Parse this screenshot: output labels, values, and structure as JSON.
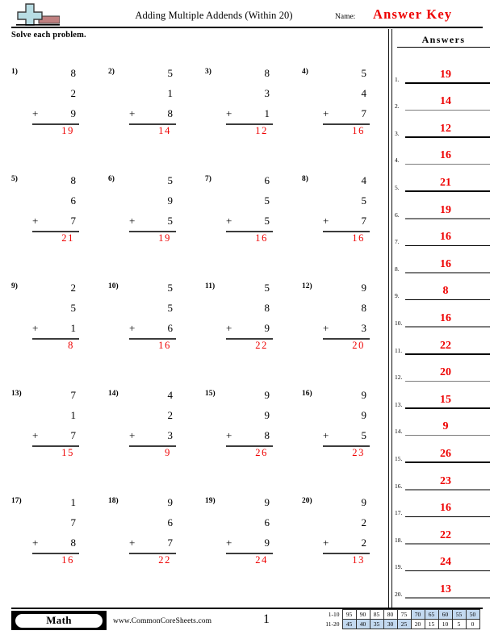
{
  "header": {
    "logo_icon": "plus-block-logo",
    "title": "Adding Multiple Addends (Within 20)",
    "name_label": "Name:",
    "answer_key_label": "Answer Key",
    "instruction": "Solve each problem."
  },
  "answers_panel": {
    "heading": "Answers",
    "items": [
      {
        "number": "1.",
        "value": "19"
      },
      {
        "number": "2.",
        "value": "14"
      },
      {
        "number": "3.",
        "value": "12"
      },
      {
        "number": "4.",
        "value": "16"
      },
      {
        "number": "5.",
        "value": "21"
      },
      {
        "number": "6.",
        "value": "19"
      },
      {
        "number": "7.",
        "value": "16"
      },
      {
        "number": "8.",
        "value": "16"
      },
      {
        "number": "9.",
        "value": "8"
      },
      {
        "number": "10.",
        "value": "16"
      },
      {
        "number": "11.",
        "value": "22"
      },
      {
        "number": "12.",
        "value": "20"
      },
      {
        "number": "13.",
        "value": "15"
      },
      {
        "number": "14.",
        "value": "9"
      },
      {
        "number": "15.",
        "value": "26"
      },
      {
        "number": "16.",
        "value": "23"
      },
      {
        "number": "17.",
        "value": "16"
      },
      {
        "number": "18.",
        "value": "22"
      },
      {
        "number": "19.",
        "value": "24"
      },
      {
        "number": "20.",
        "value": "13"
      }
    ]
  },
  "problems": [
    {
      "number": "1)",
      "a": "8",
      "b": "2",
      "c": "9",
      "op": "+",
      "sum": "19"
    },
    {
      "number": "2)",
      "a": "5",
      "b": "1",
      "c": "8",
      "op": "+",
      "sum": "14"
    },
    {
      "number": "3)",
      "a": "8",
      "b": "3",
      "c": "1",
      "op": "+",
      "sum": "12"
    },
    {
      "number": "4)",
      "a": "5",
      "b": "4",
      "c": "7",
      "op": "+",
      "sum": "16"
    },
    {
      "number": "5)",
      "a": "8",
      "b": "6",
      "c": "7",
      "op": "+",
      "sum": "21"
    },
    {
      "number": "6)",
      "a": "5",
      "b": "9",
      "c": "5",
      "op": "+",
      "sum": "19"
    },
    {
      "number": "7)",
      "a": "6",
      "b": "5",
      "c": "5",
      "op": "+",
      "sum": "16"
    },
    {
      "number": "8)",
      "a": "4",
      "b": "5",
      "c": "7",
      "op": "+",
      "sum": "16"
    },
    {
      "number": "9)",
      "a": "2",
      "b": "5",
      "c": "1",
      "op": "+",
      "sum": "8"
    },
    {
      "number": "10)",
      "a": "5",
      "b": "5",
      "c": "6",
      "op": "+",
      "sum": "16"
    },
    {
      "number": "11)",
      "a": "5",
      "b": "8",
      "c": "9",
      "op": "+",
      "sum": "22"
    },
    {
      "number": "12)",
      "a": "9",
      "b": "8",
      "c": "3",
      "op": "+",
      "sum": "20"
    },
    {
      "number": "13)",
      "a": "7",
      "b": "1",
      "c": "7",
      "op": "+",
      "sum": "15"
    },
    {
      "number": "14)",
      "a": "4",
      "b": "2",
      "c": "3",
      "op": "+",
      "sum": "9"
    },
    {
      "number": "15)",
      "a": "9",
      "b": "9",
      "c": "8",
      "op": "+",
      "sum": "26"
    },
    {
      "number": "16)",
      "a": "9",
      "b": "9",
      "c": "5",
      "op": "+",
      "sum": "23"
    },
    {
      "number": "17)",
      "a": "1",
      "b": "7",
      "c": "8",
      "op": "+",
      "sum": "16"
    },
    {
      "number": "18)",
      "a": "9",
      "b": "6",
      "c": "7",
      "op": "+",
      "sum": "22"
    },
    {
      "number": "19)",
      "a": "9",
      "b": "6",
      "c": "9",
      "op": "+",
      "sum": "24"
    },
    {
      "number": "20)",
      "a": "9",
      "b": "2",
      "c": "2",
      "op": "+",
      "sum": "13"
    }
  ],
  "footer": {
    "subject_badge": "Math",
    "website": "www.CommonCoreSheets.com",
    "page_number": "1",
    "score_table": {
      "row1_label": "1-10",
      "row2_label": "11-20",
      "row1": [
        {
          "value": "95",
          "highlighted": false
        },
        {
          "value": "90",
          "highlighted": false
        },
        {
          "value": "85",
          "highlighted": false
        },
        {
          "value": "80",
          "highlighted": false
        },
        {
          "value": "75",
          "highlighted": false
        },
        {
          "value": "70",
          "highlighted": true
        },
        {
          "value": "65",
          "highlighted": true
        },
        {
          "value": "60",
          "highlighted": true
        },
        {
          "value": "55",
          "highlighted": true
        },
        {
          "value": "50",
          "highlighted": true
        }
      ],
      "row2": [
        {
          "value": "45",
          "highlighted": true
        },
        {
          "value": "40",
          "highlighted": true
        },
        {
          "value": "35",
          "highlighted": true
        },
        {
          "value": "30",
          "highlighted": true
        },
        {
          "value": "25",
          "highlighted": true
        },
        {
          "value": "20",
          "highlighted": false
        },
        {
          "value": "15",
          "highlighted": false
        },
        {
          "value": "10",
          "highlighted": false
        },
        {
          "value": "5",
          "highlighted": false
        },
        {
          "value": "0",
          "highlighted": false
        }
      ]
    }
  },
  "colors": {
    "answer_red": "#ee0000",
    "logo_blue": "#b8dde4",
    "logo_red": "#c08080",
    "highlight_blue": "#c3d9f0"
  }
}
